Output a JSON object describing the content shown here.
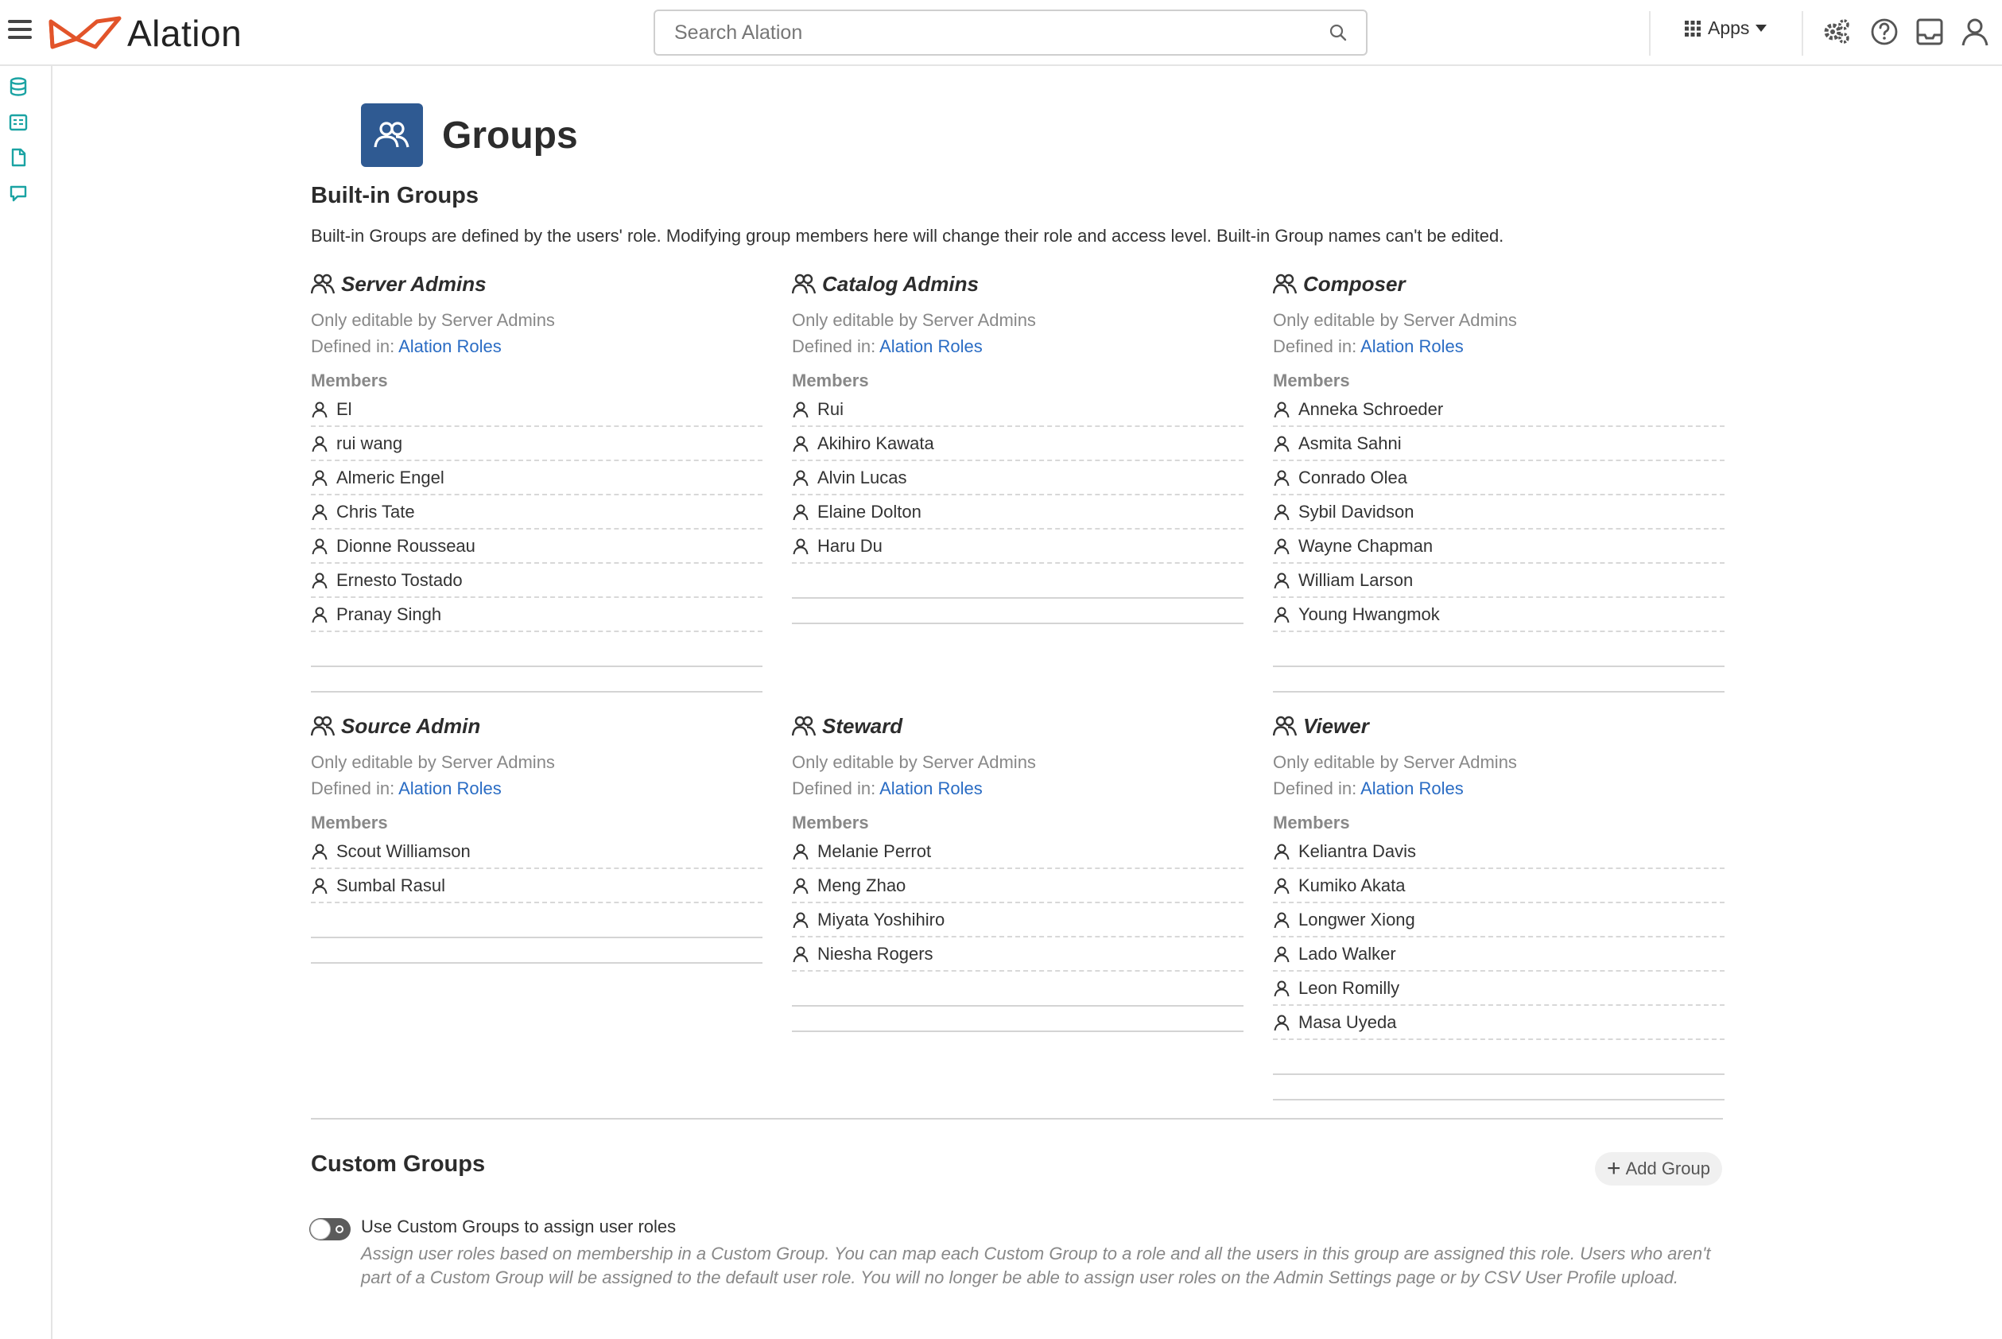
{
  "app": {
    "logo_text": "Alation",
    "brand_color": "#e2542a",
    "accent_color": "#2a6cc4",
    "badge_color": "#2f5a92",
    "rail_icon_color": "#1aa3a3"
  },
  "header": {
    "search_placeholder": "Search Alation",
    "apps_label": "Apps",
    "icons": [
      "settings-gears-icon",
      "help-icon",
      "inbox-icon",
      "user-profile-icon"
    ]
  },
  "rail": {
    "icons": [
      "database-icon",
      "catalog-icon",
      "document-icon",
      "conversation-icon"
    ]
  },
  "page": {
    "title": "Groups",
    "builtin_title": "Built-in Groups",
    "builtin_description": "Built-in Groups are defined by the users' role. Modifying group members here will change their role and access level. Built-in Group names can't be edited.",
    "groups": [
      {
        "name": "Server Admins",
        "editable_text": "Only editable by Server Admins",
        "defined_prefix": "Defined in:",
        "defined_link": "Alation Roles",
        "members_label": "Members",
        "members": [
          "El",
          "rui wang",
          "Almeric Engel",
          "Chris Tate",
          "Dionne Rousseau",
          "Ernesto Tostado",
          "Pranay Singh"
        ]
      },
      {
        "name": "Catalog Admins",
        "editable_text": "Only editable by Server Admins",
        "defined_prefix": "Defined in:",
        "defined_link": "Alation Roles",
        "members_label": "Members",
        "members": [
          "Rui",
          "Akihiro Kawata",
          "Alvin Lucas",
          "Elaine Dolton",
          "Haru Du"
        ]
      },
      {
        "name": "Composer",
        "editable_text": "Only editable by Server Admins",
        "defined_prefix": "Defined in:",
        "defined_link": "Alation Roles",
        "members_label": "Members",
        "members": [
          "Anneka Schroeder",
          "Asmita Sahni",
          "Conrado Olea",
          "Sybil Davidson",
          "Wayne Chapman",
          "William Larson",
          "Young Hwangmok"
        ]
      },
      {
        "name": "Source Admin",
        "editable_text": "Only editable by Server Admins",
        "defined_prefix": "Defined in:",
        "defined_link": "Alation Roles",
        "members_label": "Members",
        "members": [
          "Scout Williamson",
          "Sumbal Rasul"
        ]
      },
      {
        "name": "Steward",
        "editable_text": "Only editable by Server Admins",
        "defined_prefix": "Defined in:",
        "defined_link": "Alation Roles",
        "members_label": "Members",
        "members": [
          "Melanie Perrot",
          "Meng Zhao",
          "Miyata Yoshihiro",
          "Niesha Rogers"
        ]
      },
      {
        "name": "Viewer",
        "editable_text": "Only editable by Server Admins",
        "defined_prefix": "Defined in:",
        "defined_link": "Alation Roles",
        "members_label": "Members",
        "members": [
          "Keliantra Davis",
          "Kumiko Akata",
          "Longwer Xiong",
          "Lado Walker",
          "Leon Romilly",
          "Masa Uyeda"
        ]
      }
    ],
    "custom_title": "Custom Groups",
    "add_group_label": "Add Group",
    "toggle_label": "Use Custom Groups to assign user roles",
    "toggle_on": false,
    "toggle_help": "Assign user roles based on membership in a Custom Group. You can map each Custom Group to a role and all the users in this group are assigned this role. Users who aren't part of a Custom Group will be assigned to the default user role. You will no longer be able to assign user roles on the Admin Settings page or by CSV User Profile upload."
  }
}
